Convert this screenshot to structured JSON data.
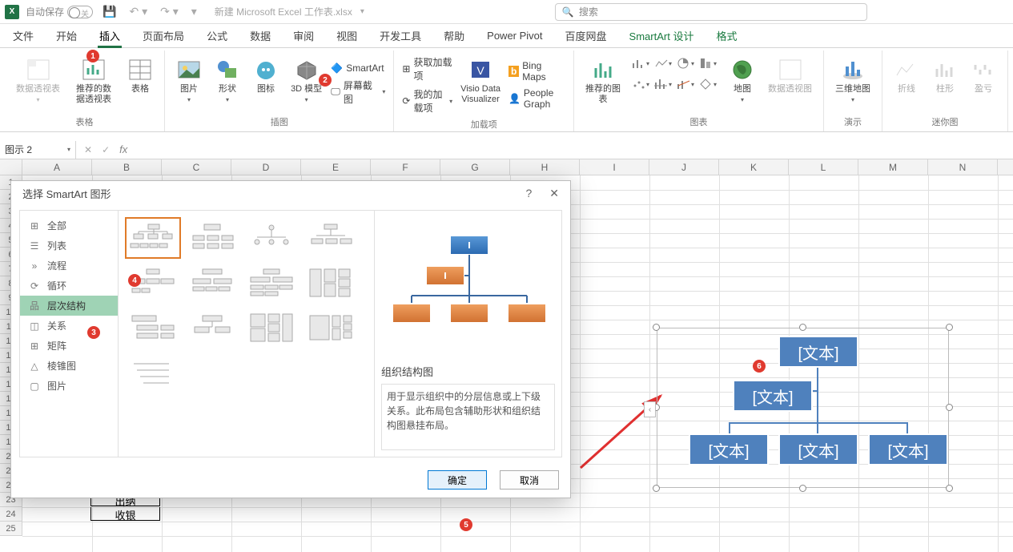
{
  "titlebar": {
    "autosave_label": "自动保存",
    "toggle_state": "关",
    "filename": "新建 Microsoft Excel 工作表.xlsx",
    "search_placeholder": "搜索"
  },
  "tabs": {
    "file": "文件",
    "home": "开始",
    "insert": "插入",
    "pagelayout": "页面布局",
    "formulas": "公式",
    "data": "数据",
    "review": "审阅",
    "view": "视图",
    "developer": "开发工具",
    "help": "帮助",
    "powerpivot": "Power Pivot",
    "baidu": "百度网盘",
    "smartart": "SmartArt 设计",
    "format": "格式"
  },
  "ribbon": {
    "groups": {
      "tables": "表格",
      "illustrations": "插图",
      "addins": "加载项",
      "charts": "图表",
      "tours": "演示",
      "sparklines": "迷你图"
    },
    "pivottable": "数据透视表",
    "rec_pivot": "推荐的数据透视表",
    "table": "表格",
    "pictures": "图片",
    "shapes": "形状",
    "icons": "图标",
    "model3d": "3D 模型",
    "smartart": "SmartArt",
    "screenshot": "屏幕截图",
    "get_addins": "获取加载项",
    "my_addins": "我的加载项",
    "visio": "Visio Data Visualizer",
    "bingmaps": "Bing Maps",
    "peoplegraph": "People Graph",
    "rec_charts": "推荐的图表",
    "maps": "地图",
    "pivotchart": "数据透视图",
    "map3d": "三维地图",
    "line": "折线",
    "column": "柱形",
    "winloss": "盈亏"
  },
  "namebox": "图示 2",
  "dialog": {
    "title": "选择 SmartArt 图形",
    "categories": {
      "all": "全部",
      "list": "列表",
      "process": "流程",
      "cycle": "循环",
      "hierarchy": "层次结构",
      "relationship": "关系",
      "matrix": "矩阵",
      "pyramid": "棱锥图",
      "picture": "图片"
    },
    "preview_title": "组织结构图",
    "preview_desc": "用于显示组织中的分层信息或上下级关系。此布局包含辅助形状和组织结构图悬挂布局。",
    "ok": "确定",
    "cancel": "取消"
  },
  "sheet_cells": {
    "b19": "出纳",
    "b20": "收银"
  },
  "smartart_node": "[文本]",
  "columns": [
    "A",
    "B",
    "C",
    "D",
    "E",
    "F",
    "G",
    "H",
    "I",
    "J",
    "K",
    "L",
    "M",
    "N"
  ],
  "badges": {
    "b1": "1",
    "b2": "2",
    "b3": "3",
    "b4": "4",
    "b5": "5",
    "b6": "6"
  }
}
